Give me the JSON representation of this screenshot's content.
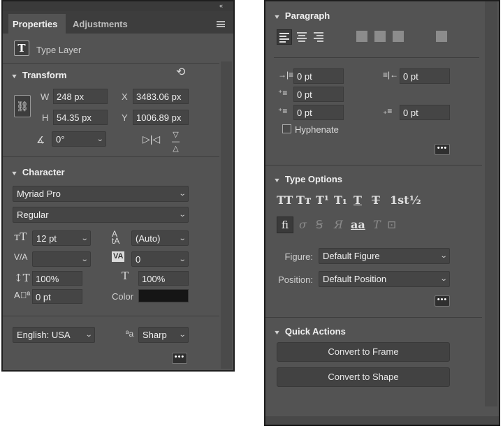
{
  "left": {
    "tabs": {
      "properties": "Properties",
      "adjustments": "Adjustments"
    },
    "layer_type": "Type Layer",
    "transform": {
      "title": "Transform",
      "w_label": "W",
      "w_value": "248 px",
      "h_label": "H",
      "h_value": "54.35 px",
      "x_label": "X",
      "x_value": "3483.06 px",
      "y_label": "Y",
      "y_value": "1006.89 px",
      "angle_value": "0°"
    },
    "character": {
      "title": "Character",
      "font_family": "Myriad Pro",
      "font_style": "Regular",
      "font_size": "12 pt",
      "leading": "(Auto)",
      "kerning": "",
      "tracking": "0",
      "vertical_scale": "100%",
      "horizontal_scale": "100%",
      "baseline_shift": "0 pt",
      "color_label": "Color",
      "color_value": "#151515",
      "language": "English: USA",
      "antialias_glyph": "ªa",
      "antialias": "Sharp"
    }
  },
  "right": {
    "paragraph": {
      "title": "Paragraph",
      "indent_left": "0 pt",
      "indent_right": "0 pt",
      "indent_first": "0 pt",
      "space_before": "0 pt",
      "space_after": "0 pt",
      "hyphenate": "Hyphenate"
    },
    "type_options": {
      "title": "Type Options",
      "glyphs": [
        "TT",
        "Tт",
        "T¹",
        "T₁",
        "T",
        "T",
        "1st",
        "½"
      ],
      "ligature_glyph": "fi",
      "figure_label": "Figure:",
      "figure_value": "Default Figure",
      "position_label": "Position:",
      "position_value": "Default Position"
    },
    "quick_actions": {
      "title": "Quick Actions",
      "convert_frame": "Convert to Frame",
      "convert_shape": "Convert to Shape"
    }
  }
}
